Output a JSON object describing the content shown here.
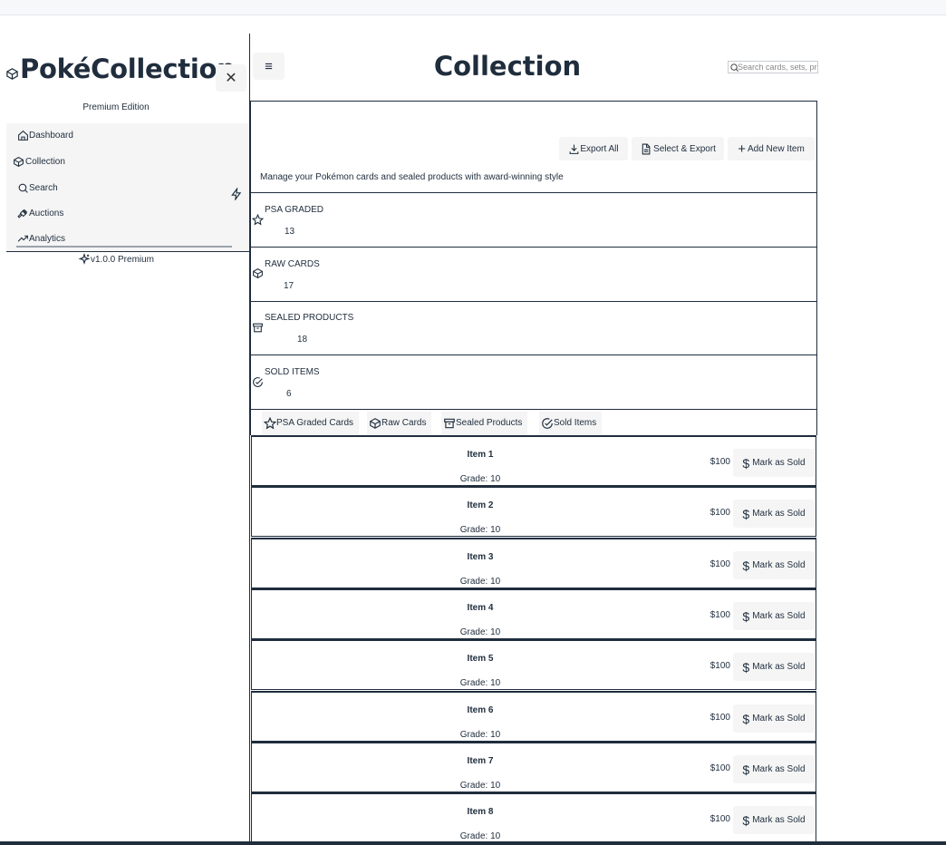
{
  "sidebar": {
    "brand": "PokéCollection",
    "edition": "Premium Edition",
    "items": [
      {
        "label": "Dashboard",
        "icon": "home-icon"
      },
      {
        "label": "Collection",
        "icon": "box-icon"
      },
      {
        "label": "Search",
        "icon": "search-icon"
      },
      {
        "label": "Auctions",
        "icon": "gavel-icon"
      },
      {
        "label": "Analytics",
        "icon": "trending-up-icon"
      }
    ],
    "version": "v1.0.0 Premium"
  },
  "header": {
    "title": "Collection",
    "search_placeholder": "Search cards, sets, products..."
  },
  "actions": {
    "export_all": "Export All",
    "select_export": "Select & Export",
    "add_new": "Add New Item"
  },
  "subtitle": "Manage your Pokémon cards and sealed products with award-winning style",
  "stats": [
    {
      "label": "PSA GRADED",
      "value": "13",
      "icon": "star-icon"
    },
    {
      "label": "RAW CARDS",
      "value": "17",
      "icon": "box-icon"
    },
    {
      "label": "SEALED PRODUCTS",
      "value": "18",
      "icon": "archive-icon"
    },
    {
      "label": "SOLD ITEMS",
      "value": "6",
      "icon": "check-circle-icon"
    }
  ],
  "tabs": [
    {
      "label": "PSA Graded Cards",
      "icon": "star-icon"
    },
    {
      "label": "Raw Cards",
      "icon": "box-icon"
    },
    {
      "label": "Sealed Products",
      "icon": "archive-icon"
    },
    {
      "label": "Sold Items",
      "icon": "check-circle-icon"
    }
  ],
  "items": [
    {
      "name": "Item 1",
      "grade": "Grade: 10",
      "price": "$100",
      "action": "Mark as Sold"
    },
    {
      "name": "Item 2",
      "grade": "Grade: 10",
      "price": "$100",
      "action": "Mark as Sold"
    },
    {
      "name": "Item 3",
      "grade": "Grade: 10",
      "price": "$100",
      "action": "Mark as Sold"
    },
    {
      "name": "Item 4",
      "grade": "Grade: 10",
      "price": "$100",
      "action": "Mark as Sold"
    },
    {
      "name": "Item 5",
      "grade": "Grade: 10",
      "price": "$100",
      "action": "Mark as Sold"
    },
    {
      "name": "Item 6",
      "grade": "Grade: 10",
      "price": "$100",
      "action": "Mark as Sold"
    },
    {
      "name": "Item 7",
      "grade": "Grade: 10",
      "price": "$100",
      "action": "Mark as Sold"
    },
    {
      "name": "Item 8",
      "grade": "Grade: 10",
      "price": "$100",
      "action": "Mark as Sold"
    }
  ],
  "colors": {
    "text": "#1f2d3d",
    "button_bg": "#f5f5f5",
    "border": "#1f2d3d"
  }
}
